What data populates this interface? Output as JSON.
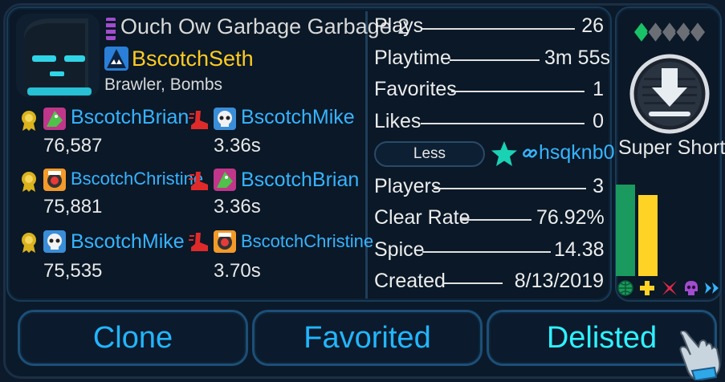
{
  "level": {
    "title": "Ouch Ow Garbage Garbage 2",
    "creator": "BscotchSeth",
    "tags": "Brawler, Bombs",
    "level_icon": "level-icon",
    "creator_avatar_icon": "shark-avatar-icon"
  },
  "leaderboards": {
    "score": [
      {
        "name": "BscotchBrian",
        "value": "76,587",
        "avatar_icon": "dino-avatar-icon"
      },
      {
        "name": "BscotchChristine",
        "value": "75,881",
        "avatar_icon": "robot-avatar-icon"
      },
      {
        "name": "BscotchMike",
        "value": "75,535",
        "avatar_icon": "skull-avatar-icon"
      }
    ],
    "speed": [
      {
        "name": "BscotchMike",
        "value": "3.36s",
        "avatar_icon": "skull-avatar-icon"
      },
      {
        "name": "BscotchBrian",
        "value": "3.36s",
        "avatar_icon": "dino-avatar-icon"
      },
      {
        "name": "BscotchChristine",
        "value": "3.70s",
        "avatar_icon": "robot-avatar-icon"
      }
    ],
    "score_icon": "medal-icon",
    "speed_icon": "boot-icon"
  },
  "stats": {
    "top": [
      {
        "label": "Plays",
        "value": "26"
      },
      {
        "label": "Playtime",
        "value": "3m 55s"
      },
      {
        "label": "Favorites",
        "value": "1"
      },
      {
        "label": "Likes",
        "value": "0"
      }
    ],
    "bottom": [
      {
        "label": "Players",
        "value": "3"
      },
      {
        "label": "Clear Rate",
        "value": "76.92%"
      },
      {
        "label": "Spice",
        "value": "14.38"
      },
      {
        "label": "Created",
        "value": "8/13/2019"
      }
    ]
  },
  "toggle": {
    "less_label": "Less",
    "share_code": "hsqknb0"
  },
  "difficulty": {
    "level_label": "Super Short",
    "diamonds_filled": 1,
    "diamonds_total": 5,
    "bars": [
      {
        "icon": "globe-icon",
        "value": 1.0,
        "color": "#1a9a5e"
      },
      {
        "icon": "puzzle-icon",
        "value": 0.89,
        "color": "#ffd326"
      }
    ],
    "extra_icons": [
      "spikes-icon",
      "skull-icon",
      "fast-forward-icon"
    ]
  },
  "buttons": {
    "clone": "Clone",
    "favorited": "Favorited",
    "delisted": "Delisted"
  },
  "colors": {
    "link": "#36b4ff",
    "creator": "#ffcc22",
    "accent_green": "#19c267",
    "button_text": "#22b6ff"
  }
}
